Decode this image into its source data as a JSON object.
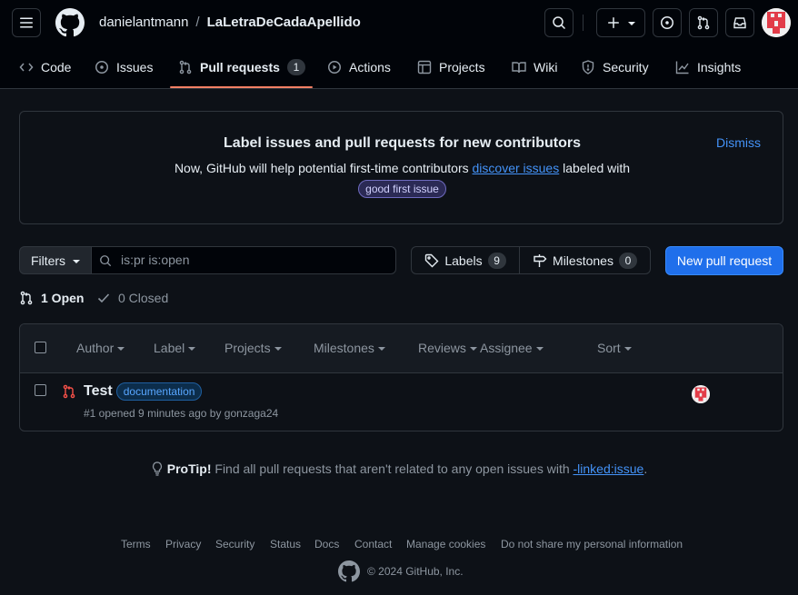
{
  "header": {
    "owner": "danielantmann",
    "separator": "/",
    "repo": "LaLetraDeCadaApellido"
  },
  "tabs": [
    {
      "label": "Code",
      "icon": "code-icon"
    },
    {
      "label": "Issues",
      "icon": "issue-icon"
    },
    {
      "label": "Pull requests",
      "icon": "pull-request-icon",
      "count": "1",
      "selected": true
    },
    {
      "label": "Actions",
      "icon": "play-icon"
    },
    {
      "label": "Projects",
      "icon": "table-icon"
    },
    {
      "label": "Wiki",
      "icon": "book-icon"
    },
    {
      "label": "Security",
      "icon": "shield-icon"
    },
    {
      "label": "Insights",
      "icon": "graph-icon"
    }
  ],
  "banner": {
    "title": "Label issues and pull requests for new contributors",
    "text_before": "Now, GitHub will help potential first-time contributors",
    "link": "discover issues",
    "text_after": "labeled with",
    "label": "good first issue",
    "dismiss": "Dismiss"
  },
  "filters": {
    "button": "Filters",
    "query": "is:pr is:open",
    "labels": "Labels",
    "labels_count": "9",
    "milestones": "Milestones",
    "milestones_count": "0",
    "new_pr": "New pull request"
  },
  "states": {
    "open": "1 Open",
    "closed": "0 Closed"
  },
  "list_header": {
    "author": "Author",
    "label": "Label",
    "projects": "Projects",
    "milestones": "Milestones",
    "reviews": "Reviews",
    "assignee": "Assignee",
    "sort": "Sort"
  },
  "pull_requests": [
    {
      "title": "Test",
      "label": "documentation",
      "meta": "#1 opened 9 minutes ago by gonzaga24"
    }
  ],
  "protip": {
    "strong": "ProTip!",
    "text": "Find all pull requests that aren't related to any open issues with",
    "link": "-linked:issue",
    "period": "."
  },
  "footer": {
    "links": [
      "Terms",
      "Privacy",
      "Security",
      "Status",
      "Docs",
      "Contact",
      "Manage cookies",
      "Do not share my personal information"
    ],
    "copyright": "© 2024 GitHub, Inc."
  },
  "colors": {
    "background": "#0d1117",
    "accent_blue": "#4493f8",
    "button_blue": "#1f6feb",
    "open_pr": "#3fb950",
    "selected_underline": "#f78166"
  }
}
